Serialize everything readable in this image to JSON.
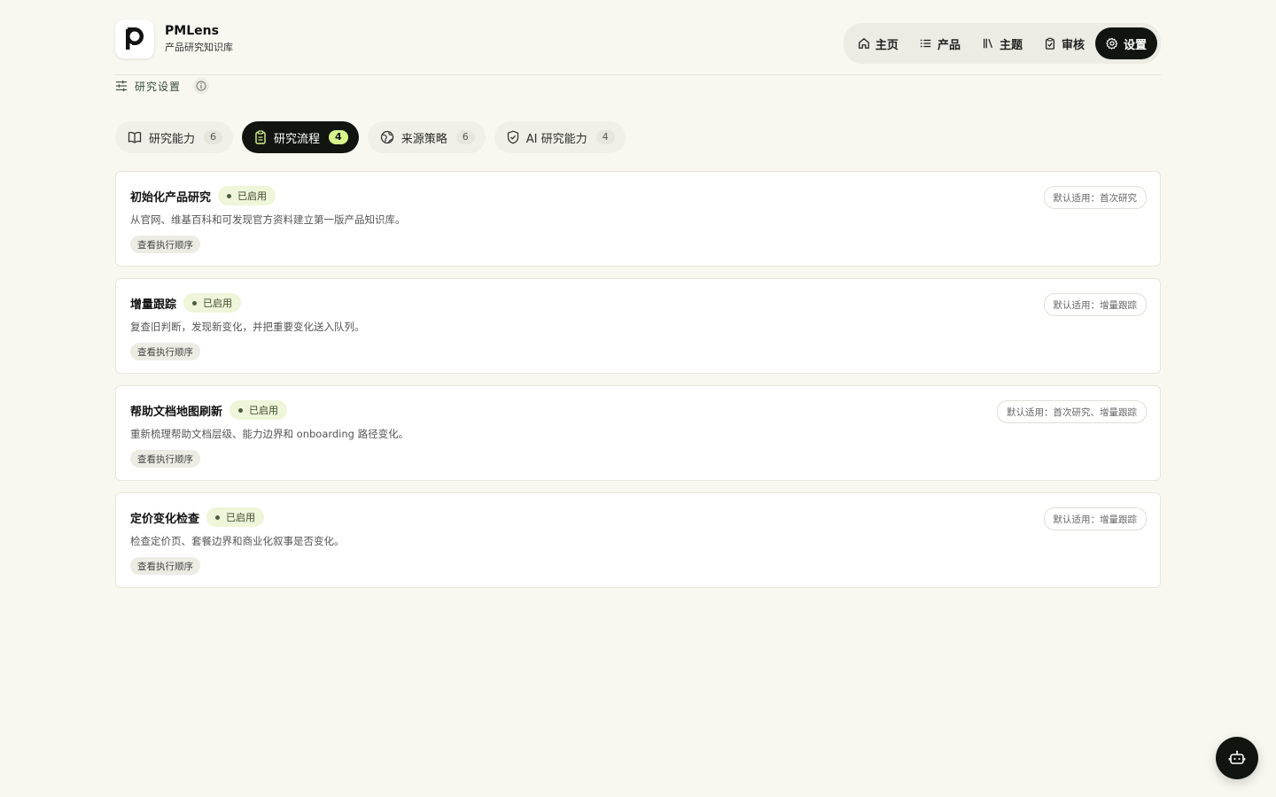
{
  "brand": {
    "name": "PMLens",
    "subtitle": "产品研究知识库",
    "logo_letter": "p"
  },
  "nav": {
    "items": [
      {
        "label": "主页",
        "icon": "home-icon"
      },
      {
        "label": "产品",
        "icon": "list-icon"
      },
      {
        "label": "主题",
        "icon": "library-icon"
      },
      {
        "label": "审核",
        "icon": "clipboard-check-icon"
      },
      {
        "label": "设置",
        "icon": "gear-icon",
        "active": true
      }
    ]
  },
  "subbar": {
    "label": "研究设置"
  },
  "tabs": [
    {
      "label": "研究能力",
      "count": "6",
      "icon": "book-open-icon"
    },
    {
      "label": "研究流程",
      "count": "4",
      "icon": "clipboard-icon",
      "active": true
    },
    {
      "label": "来源策略",
      "count": "6",
      "icon": "globe-icon"
    },
    {
      "label": "AI 研究能力",
      "count": "4",
      "icon": "shield-icon"
    }
  ],
  "cards": [
    {
      "title": "初始化产品研究",
      "status": "已启用",
      "desc": "从官网、维基百科和可发现官方资料建立第一版产品知识库。",
      "button": "查看执行顺序",
      "scope": "默认适用：首次研究"
    },
    {
      "title": "增量跟踪",
      "status": "已启用",
      "desc": "复查旧判断，发现新变化，并把重要变化送入队列。",
      "button": "查看执行顺序",
      "scope": "默认适用：增量跟踪"
    },
    {
      "title": "帮助文档地图刷新",
      "status": "已启用",
      "desc": "重新梳理帮助文档层级、能力边界和 onboarding 路径变化。",
      "button": "查看执行顺序",
      "scope": "默认适用：首次研究、增量跟踪"
    },
    {
      "title": "定价变化检查",
      "status": "已启用",
      "desc": "检查定价页、套餐边界和商业化叙事是否变化。",
      "button": "查看执行顺序",
      "scope": "默认适用：增量跟踪"
    }
  ],
  "colors": {
    "background": "#f8f8f1",
    "dark": "#12140f",
    "accent": "#d7f58c",
    "status_bg": "#eef5d8"
  },
  "fab": {
    "icon": "bot-icon"
  }
}
